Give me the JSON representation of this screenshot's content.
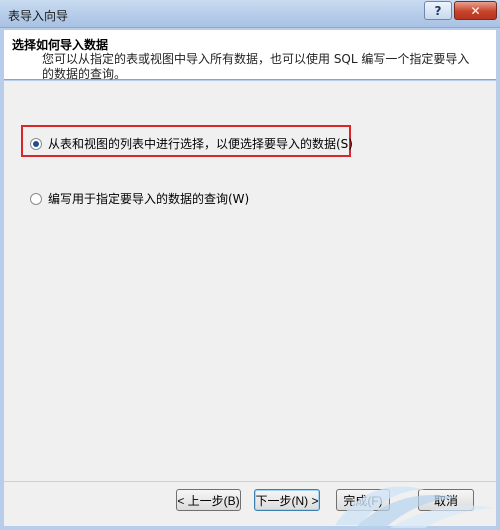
{
  "window": {
    "title": "表导入向导",
    "help_label": "?",
    "close_label": "✕"
  },
  "header": {
    "title": "选择如何导入数据",
    "description": "您可以从指定的表或视图中导入所有数据，也可以使用 SQL 编写一个指定要导入的数据的查询。"
  },
  "options": [
    {
      "label": "从表和视图的列表中进行选择，以便选择要导入的数据(S)",
      "selected": true
    },
    {
      "label": "编写用于指定要导入的数据的查询(W)",
      "selected": false
    }
  ],
  "buttons": {
    "back": "< 上一步(B)",
    "next": "下一步(N) >",
    "finish": "完成(F)",
    "cancel": "取消"
  },
  "colors": {
    "highlight_border": "#d8262b",
    "titlebar": "#b7cde9"
  }
}
